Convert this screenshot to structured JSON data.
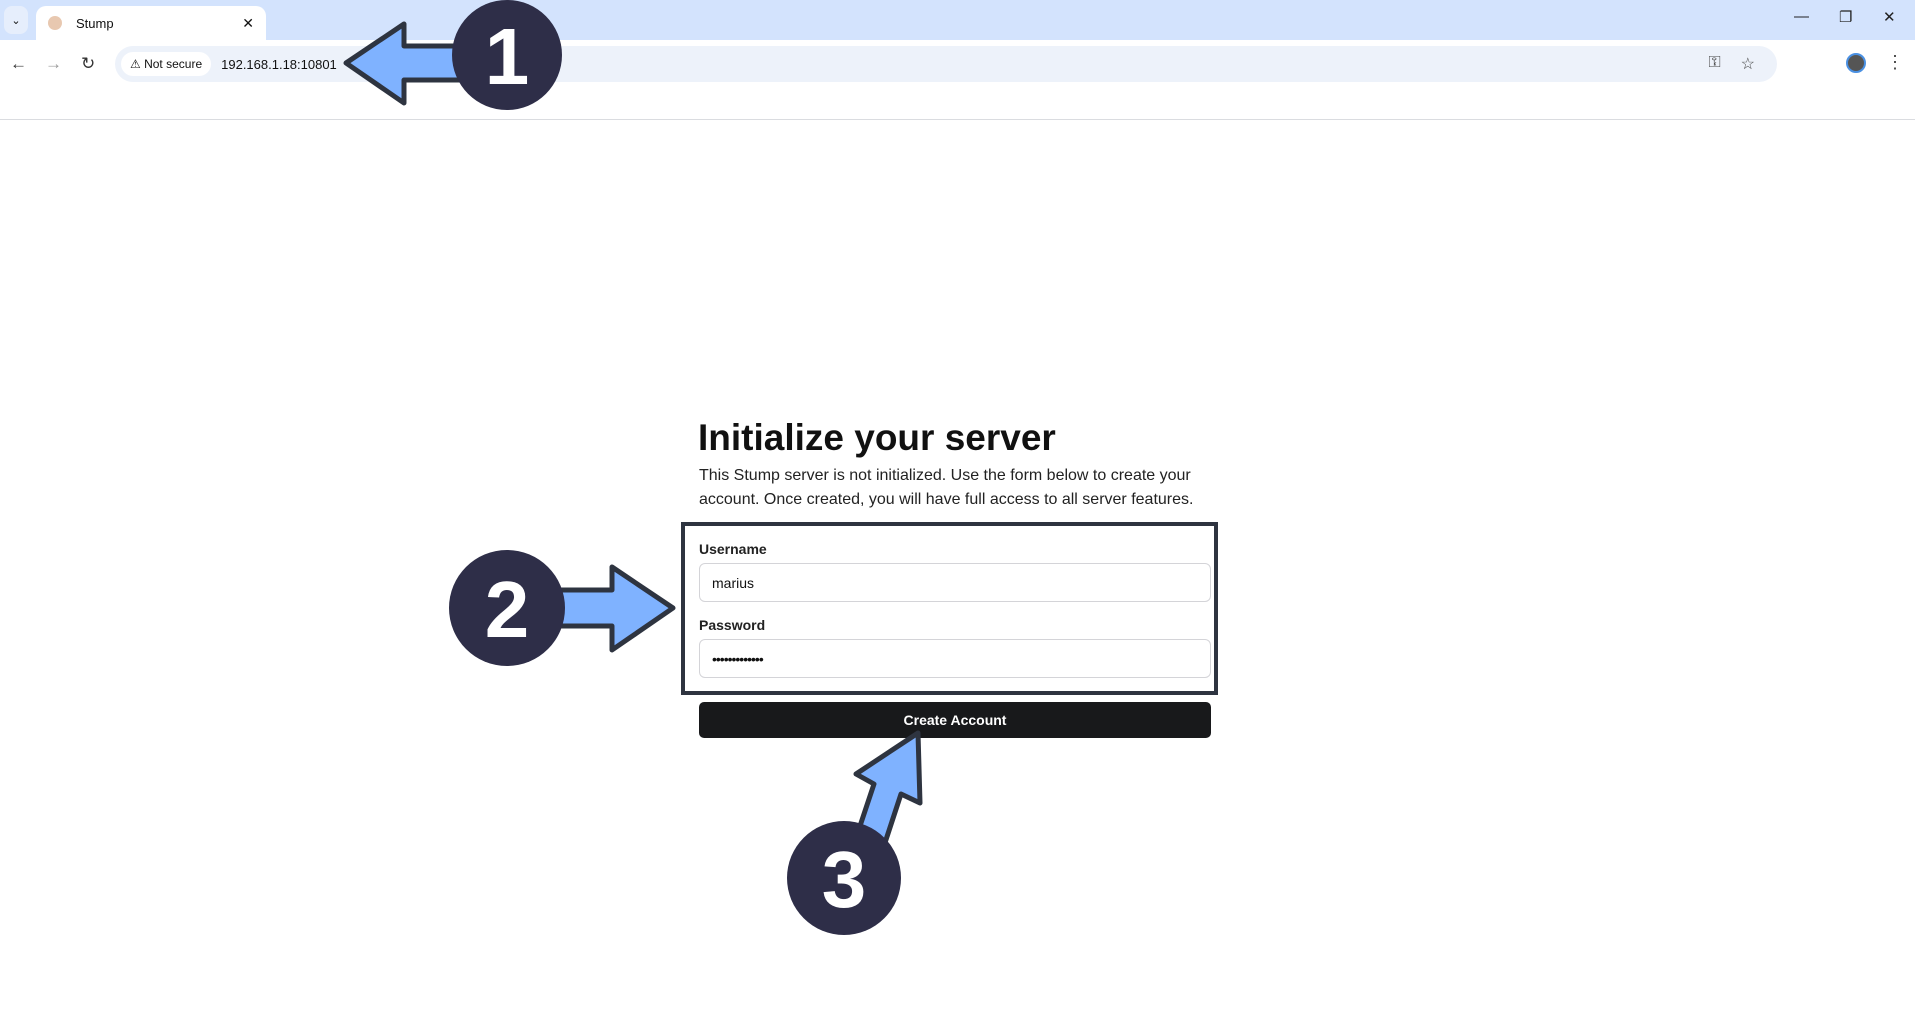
{
  "browser": {
    "tab_title": "Stump",
    "tab_close": "✕",
    "security_chip": "Not secure",
    "url": "192.168.1.18:10801",
    "icons": [
      "chevron-down-icon",
      "back-icon",
      "forward-icon",
      "reload-icon",
      "warning-icon",
      "key-icon",
      "star-icon",
      "avatar",
      "more-icon",
      "minimize-icon",
      "restore-icon",
      "close-icon"
    ]
  },
  "page": {
    "title": "Initialize your server",
    "description": "This Stump server is not initialized. Use the form below to create your account. Once created, you will have full access to all server features.",
    "username_label": "Username",
    "username_value": "marius",
    "password_label": "Password",
    "password_value": "•••••••••••••",
    "submit_label": "Create Account"
  },
  "annotations": {
    "step1": "1",
    "step2": "2",
    "step3": "3",
    "arrow_fill": "#7fb2ff",
    "badge_fill": "#2e2e48"
  }
}
